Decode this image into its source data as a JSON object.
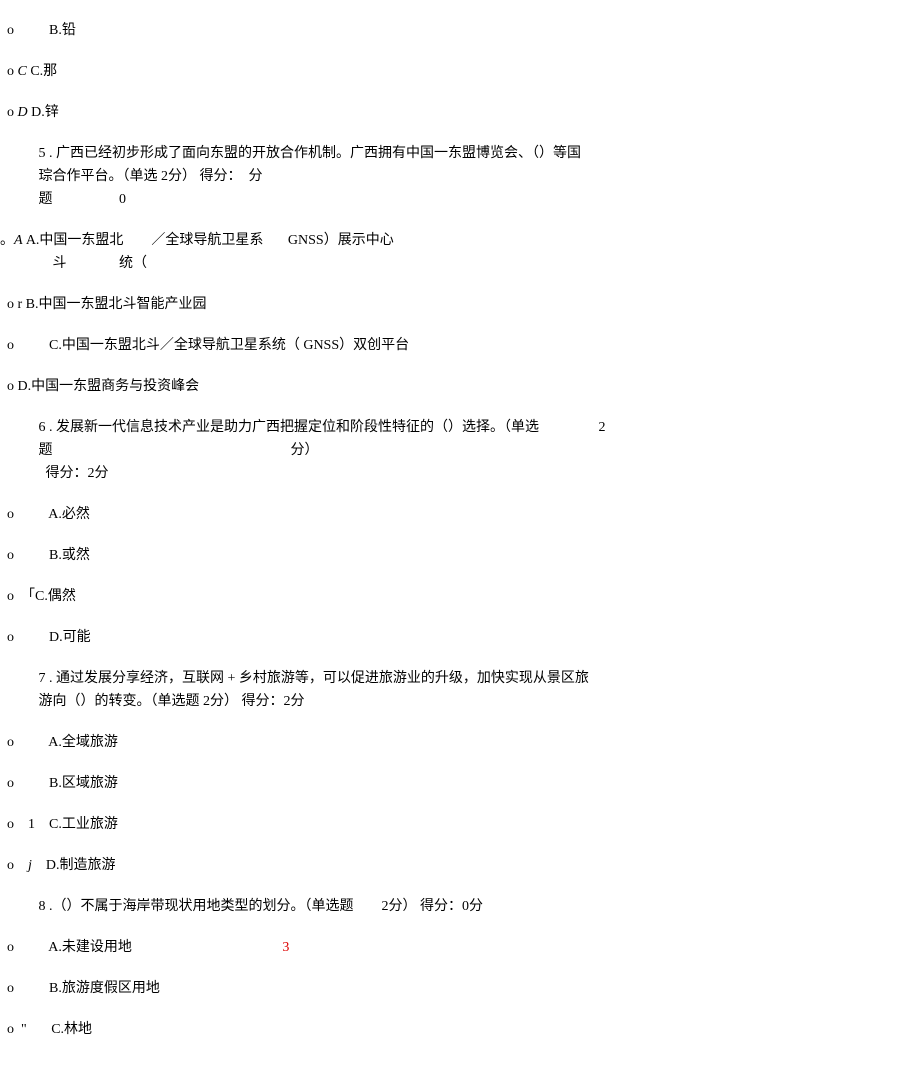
{
  "lines": [
    {
      "pre": "  o          ",
      "text": "B.铅",
      "cls": "line"
    },
    {
      "pre": "  o ",
      "italic": "C ",
      "text": "C.那",
      "cls": "line"
    },
    {
      "pre": "  o ",
      "italic": "D ",
      "text": "D.锌",
      "cls": "line"
    },
    {
      "pre": "           ",
      "text": "5 . 广西已经初步形成了面向东盟的开放合作机制。广西拥有中国一东盟博览会、（）等国",
      "cls": "line-tight"
    },
    {
      "pre": "           ",
      "text": "琮合作平台。（单选 2分） 得分：  分",
      "cls": "line-tight"
    },
    {
      "pre": "           ",
      "text": "题                   0",
      "cls": "line"
    },
    {
      "pre": "。",
      "italic": "A ",
      "text": "A.中国一东盟北        ／全球导航卫星系       GNSS）展示中心",
      "cls": "line-tight"
    },
    {
      "pre": "               ",
      "text": "斗               统（",
      "cls": "line"
    },
    {
      "pre": "  o r ",
      "text": "B.中国一东盟北斗智能产业园",
      "cls": "line"
    },
    {
      "pre": "  o          ",
      "text": "C.中国一东盟北斗／全球导航卫星系统（ GNSS）双创平台",
      "cls": "line"
    },
    {
      "pre": "  o ",
      "text": "D.中国一东盟商务与投资峰会",
      "cls": "line"
    },
    {
      "pre": "           ",
      "text": "6 . 发展新一代信息技术产业是助力广西把握定位和阶段性特征的（）选择。（单选                 2",
      "cls": "line-tight"
    },
    {
      "pre": "           ",
      "text": "题                                                                    分）",
      "cls": "line-tight"
    },
    {
      "pre": "             ",
      "text": "得分：2分",
      "cls": "line"
    },
    {
      "pre": "  o          ",
      "text": "A.必然",
      "cls": "line"
    },
    {
      "pre": "  o          ",
      "text": "B.或然",
      "cls": "line"
    },
    {
      "pre": "  o  ",
      "text": "「C.偶然",
      "cls": "line"
    },
    {
      "pre": "  o          ",
      "text": "D.可能",
      "cls": "line"
    },
    {
      "pre": "           ",
      "text": "7 . 通过发展分享经济，互联网 + 乡村旅游等，可以促进旅游业的升级，加快实现从景区旅",
      "cls": "line-tight"
    },
    {
      "pre": "           ",
      "text": "游向（）的转变。（单选题 2分） 得分：2分",
      "cls": "line"
    },
    {
      "pre": "  o          ",
      "text": "A.全域旅游",
      "cls": "line"
    },
    {
      "pre": "  o          ",
      "text": "B.区域旅游",
      "cls": "line"
    },
    {
      "pre": "  o    1    ",
      "text": "C.工业旅游",
      "cls": "line"
    },
    {
      "pre": "  o    ",
      "italic": "j    ",
      "text": "D.制造旅游",
      "cls": "line"
    },
    {
      "pre": "           ",
      "text": "8 .（）不属于海岸带现状用地类型的划分。（单选题        2分） 得分：0分",
      "cls": "line"
    },
    {
      "pre": "  o          ",
      "text": "A.未建设用地",
      "after_red": "3",
      "after_pad": "                                           ",
      "cls": "line"
    },
    {
      "pre": "  o          ",
      "text": "B.旅游度假区用地",
      "cls": "line"
    },
    {
      "pre": "  o  \"       ",
      "text": "C.林地",
      "cls": "line"
    }
  ]
}
